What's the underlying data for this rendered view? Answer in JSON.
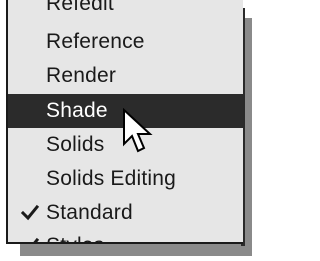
{
  "menu": {
    "items": [
      {
        "label": "Refedit",
        "checked": false,
        "highlighted": false
      },
      {
        "label": "Reference",
        "checked": false,
        "highlighted": false
      },
      {
        "label": "Render",
        "checked": false,
        "highlighted": false
      },
      {
        "label": "Shade",
        "checked": false,
        "highlighted": true
      },
      {
        "label": "Solids",
        "checked": false,
        "highlighted": false
      },
      {
        "label": "Solids Editing",
        "checked": false,
        "highlighted": false
      },
      {
        "label": "Standard",
        "checked": true,
        "highlighted": false
      },
      {
        "label": "Styles",
        "checked": true,
        "highlighted": false
      }
    ]
  },
  "icons": {
    "check": "check-icon",
    "cursor": "mouse-pointer-icon"
  },
  "colors": {
    "menu_background": "#e6e6e6",
    "highlight_background": "#2b2b2b",
    "highlight_text": "#ffffff",
    "text": "#1a1a1a",
    "shadow": "#8a8a8a"
  }
}
